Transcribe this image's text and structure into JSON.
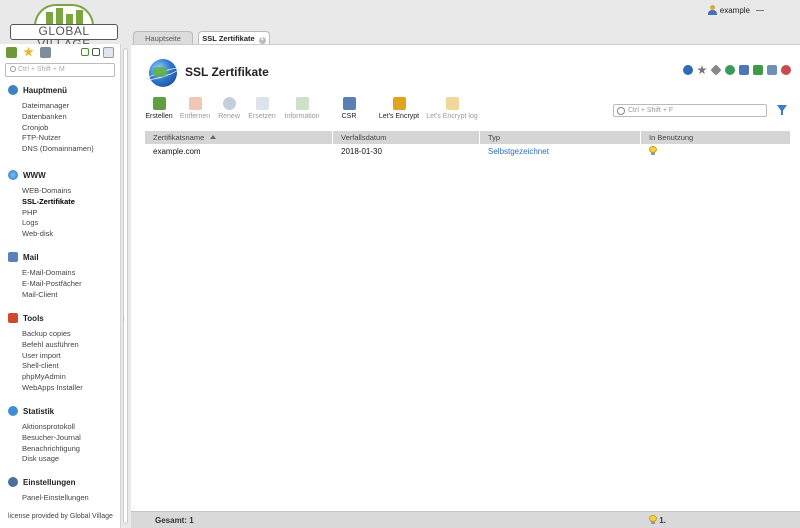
{
  "brand": {
    "name": "GLOBAL VILLAGE",
    "accent": "#7aa53f"
  },
  "user": {
    "name": "example"
  },
  "sidebar": {
    "search_placeholder": "Ctrl + Shift + M",
    "sections": [
      {
        "title": "Hauptmenü",
        "icon": "home-icon",
        "items": [
          "Dateimanager",
          "Datenbanken",
          "Cronjob",
          "FTP-Nutzer",
          "DNS (Domainnamen)"
        ]
      },
      {
        "title": "WWW",
        "icon": "globe-icon",
        "items": [
          "WEB-Domains",
          "SSL-Zertifikate",
          "PHP",
          "Logs",
          "Web-disk"
        ]
      },
      {
        "title": "Mail",
        "icon": "mail-icon",
        "items": [
          "E-Mail-Domains",
          "E-Mail-Postfächer",
          "Mail-Client"
        ]
      },
      {
        "title": "Tools",
        "icon": "tools-icon",
        "items": [
          "Backup copies",
          "Befehl ausführen",
          "User import",
          "Shell-client",
          "phpMyAdmin",
          "WebApps Installer"
        ]
      },
      {
        "title": "Statistik",
        "icon": "statistics-icon",
        "items": [
          "Aktionsprotokoll",
          "Besucher-Journal",
          "Benachrichtigung",
          "Disk usage"
        ]
      },
      {
        "title": "Einstellungen",
        "icon": "settings-icon",
        "items": [
          "Panel-Einstellungen"
        ]
      }
    ],
    "active_item": "SSL-Zertifikate",
    "footer": "license provided by Global Village"
  },
  "tabs": [
    {
      "label": "Hauptseite",
      "active": false
    },
    {
      "label": "SSL Zertifikate",
      "active": true
    }
  ],
  "page": {
    "title": "SSL Zertifikate"
  },
  "toolbar": [
    {
      "label": "Erstellen",
      "enabled": true,
      "icon": "create-icon"
    },
    {
      "label": "Entfernen",
      "enabled": false,
      "icon": "delete-icon"
    },
    {
      "label": "Renew",
      "enabled": false,
      "icon": "renew-icon"
    },
    {
      "label": "Ersetzen",
      "enabled": false,
      "icon": "replace-icon"
    },
    {
      "label": "Information",
      "enabled": false,
      "icon": "info-icon"
    },
    {
      "label": "CSR",
      "enabled": true,
      "icon": "csr-icon"
    },
    {
      "label": "Let's Encrypt",
      "enabled": true,
      "icon": "lets-encrypt-icon"
    },
    {
      "label": "Let's Encrypt log",
      "enabled": false,
      "icon": "lets-encrypt-log-icon"
    }
  ],
  "search": {
    "placeholder": "Ctrl + Shift + F"
  },
  "table": {
    "columns": [
      "Zertifikatsname",
      "Verfallsdatum",
      "Typ",
      "In Benutzung"
    ],
    "rows": [
      {
        "name": "example.com",
        "expires": "2018-01-30",
        "type": "Selbstgezeichnet",
        "in_use": true
      }
    ]
  },
  "footer": {
    "total": "Gesamt: 1",
    "in_use_count": "1."
  }
}
